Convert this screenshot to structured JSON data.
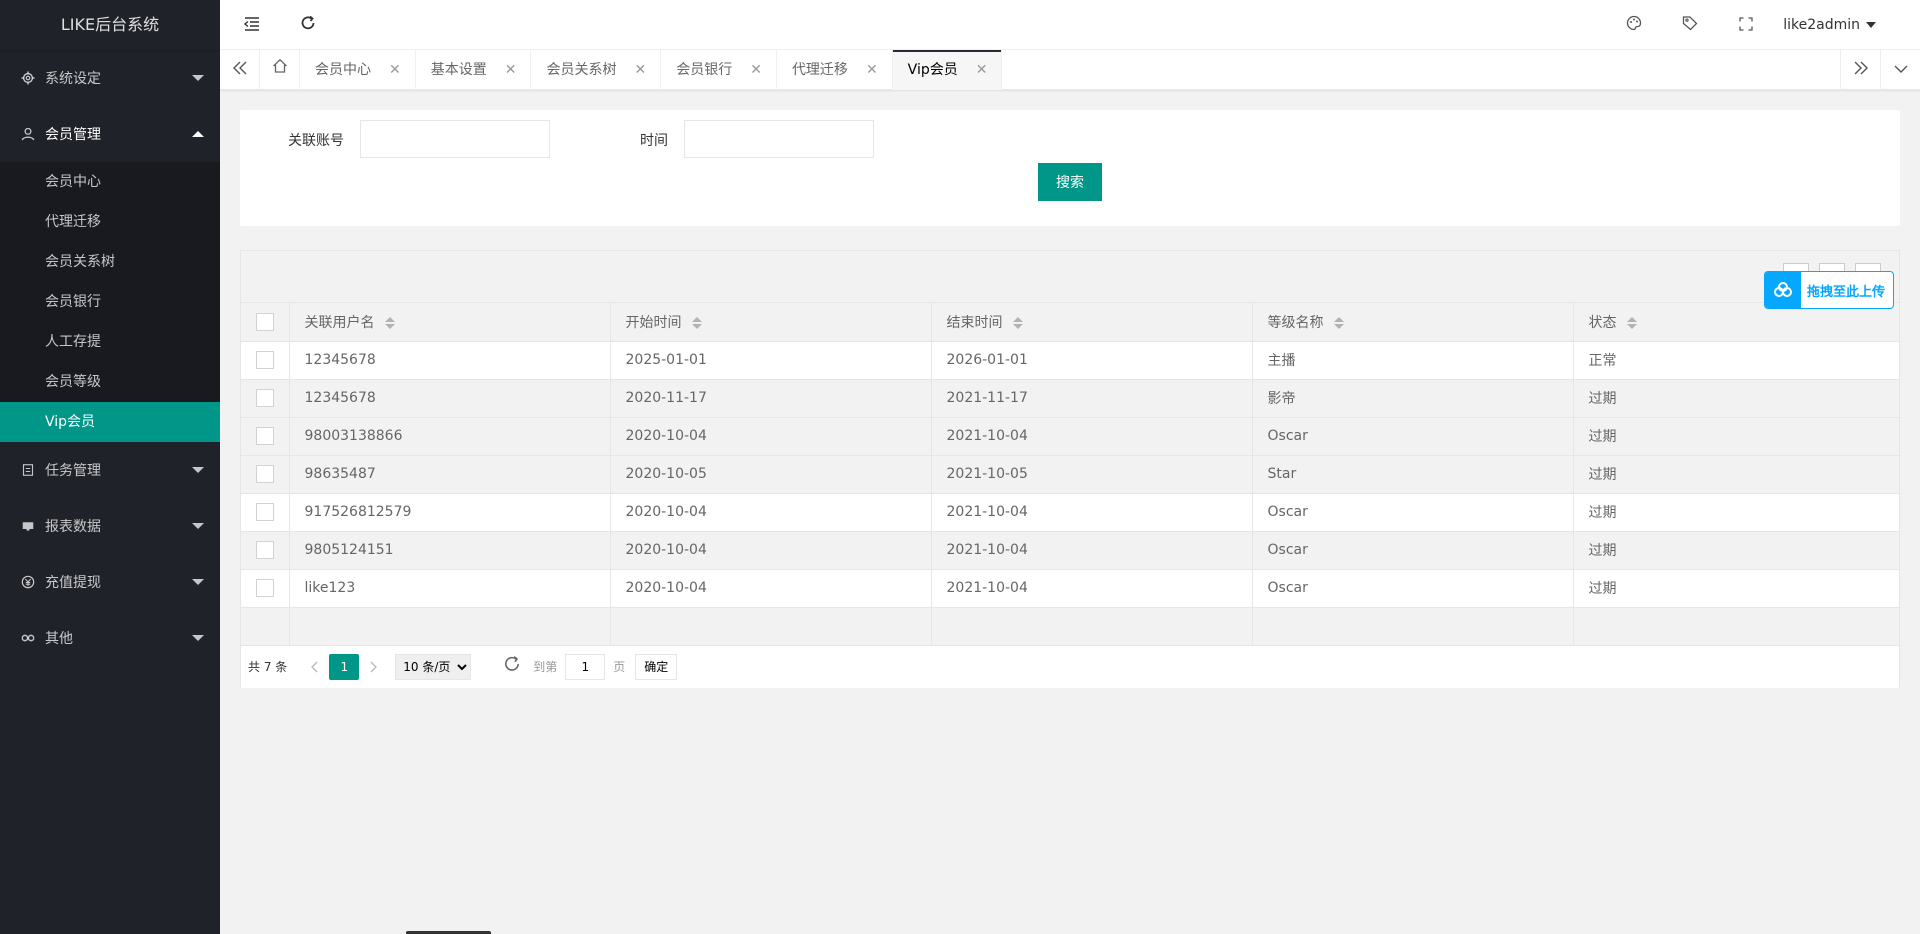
{
  "app": {
    "title": "LIKE后台系统"
  },
  "sidebar": {
    "groups": [
      {
        "label": "系统设定",
        "icon": "gear-icon",
        "open": false
      },
      {
        "label": "会员管理",
        "icon": "user-icon",
        "open": true,
        "items": [
          {
            "label": "会员中心"
          },
          {
            "label": "代理迁移"
          },
          {
            "label": "会员关系树"
          },
          {
            "label": "会员银行"
          },
          {
            "label": "人工存提"
          },
          {
            "label": "会员等级"
          },
          {
            "label": "Vip会员",
            "active": true
          }
        ]
      },
      {
        "label": "任务管理",
        "icon": "task-icon",
        "open": false
      },
      {
        "label": "报表数据",
        "icon": "report-icon",
        "open": false
      },
      {
        "label": "充值提现",
        "icon": "yen-icon",
        "open": false
      },
      {
        "label": "其他",
        "icon": "link-icon",
        "open": false
      }
    ]
  },
  "header": {
    "user": "like2admin"
  },
  "tabs": [
    {
      "label": "会员中心"
    },
    {
      "label": "基本设置"
    },
    {
      "label": "会员关系树"
    },
    {
      "label": "会员银行"
    },
    {
      "label": "代理迁移"
    },
    {
      "label": "Vip会员",
      "active": true
    }
  ],
  "search": {
    "account_label": "关联账号",
    "account_value": "",
    "time_label": "时间",
    "time_value": "",
    "button": "搜索"
  },
  "upload_badge": "拖拽至此上传",
  "table": {
    "columns": [
      "关联用户名",
      "开始时间",
      "结束时间",
      "等级名称",
      "状态"
    ],
    "rows": [
      [
        "12345678",
        "2025-01-01",
        "2026-01-01",
        "主播",
        "正常"
      ],
      [
        "12345678",
        "2020-11-17",
        "2021-11-17",
        "影帝",
        "过期"
      ],
      [
        "98003138866",
        "2020-10-04",
        "2021-10-04",
        "Oscar",
        "过期"
      ],
      [
        "98635487",
        "2020-10-05",
        "2021-10-05",
        "Star",
        "过期"
      ],
      [
        "917526812579",
        "2020-10-04",
        "2021-10-04",
        "Oscar",
        "过期"
      ],
      [
        "9805124151",
        "2020-10-04",
        "2021-10-04",
        "Oscar",
        "过期"
      ],
      [
        "like123",
        "2020-10-04",
        "2021-10-04",
        "Oscar",
        "过期"
      ]
    ]
  },
  "pager": {
    "total": "共 7 条",
    "current_page": "1",
    "page_size": "10 条/页",
    "page_size_options": [
      "10 条/页"
    ],
    "goto_label": "到第",
    "goto_value": "1",
    "page_unit": "页",
    "confirm": "确定"
  }
}
